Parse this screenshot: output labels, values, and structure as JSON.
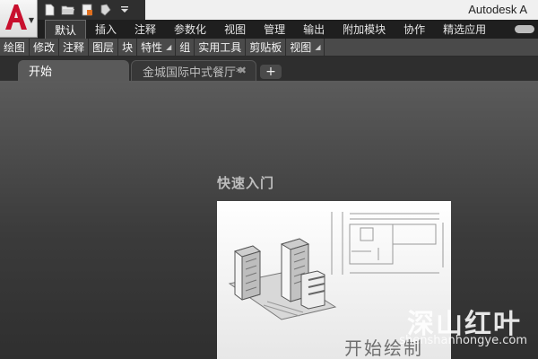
{
  "title_bar": {
    "app_title": "Autodesk A"
  },
  "quick_access": {
    "icons": [
      "new-icon",
      "open-icon",
      "save-icon",
      "print-icon",
      "dropdown-icon"
    ]
  },
  "ribbon": {
    "tabs": [
      {
        "label": "默认",
        "active": true
      },
      {
        "label": "插入"
      },
      {
        "label": "注释"
      },
      {
        "label": "参数化"
      },
      {
        "label": "视图"
      },
      {
        "label": "管理"
      },
      {
        "label": "输出"
      },
      {
        "label": "附加模块"
      },
      {
        "label": "协作"
      },
      {
        "label": "精选应用"
      }
    ],
    "panels": [
      {
        "label": "绘图"
      },
      {
        "label": "修改"
      },
      {
        "label": "注释"
      },
      {
        "label": "图层"
      },
      {
        "label": "块"
      },
      {
        "label": "特性",
        "expander": true
      },
      {
        "label": "组"
      },
      {
        "label": "实用工具"
      },
      {
        "label": "剪贴板"
      },
      {
        "label": "视图",
        "expander": true
      }
    ]
  },
  "document_tabs": {
    "start_tab": "开始",
    "file_tab": "金城国际中式餐厅*",
    "close_glyph": "✖",
    "new_tab_glyph": "+"
  },
  "main": {
    "section_title": "快速入门",
    "card_label": "开始绘制"
  },
  "watermark": {
    "chinese": "深山红叶",
    "url": "shenshanhongye.com"
  },
  "colors": {
    "app_logo_red": "#c8102e",
    "ribbon_bg": "#1f1f1f",
    "panel_bg": "#4a4a4a"
  }
}
